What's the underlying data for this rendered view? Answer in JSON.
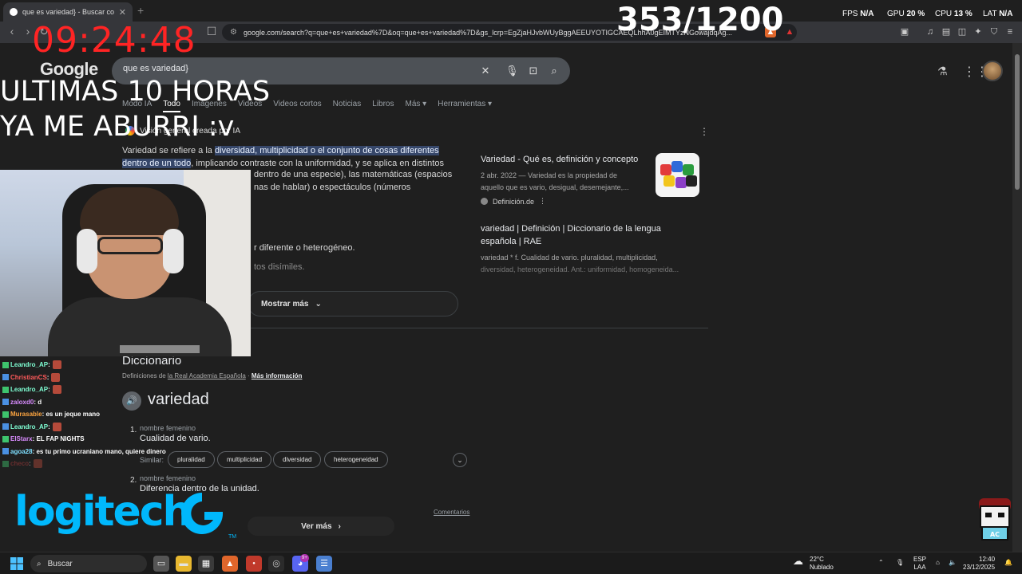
{
  "browser": {
    "tab_title": "que es variedad} - Buscar con G...",
    "url": "google.com/search?q=que+es+variedad%7D&oq=que+es+variedad%7D&gs_lcrp=EgZjaHJvbWUyBggAEEUYOTIGCAEQLhhA0gEIMTYzNGowajdqAg..."
  },
  "search": {
    "logo": "Google",
    "query": "que es variedad}",
    "tabs": [
      "Modo IA",
      "Todo",
      "Imágenes",
      "Videos",
      "Videos cortos",
      "Noticias",
      "Libros",
      "Más",
      "Herramientas"
    ],
    "active_tab": "Todo"
  },
  "ai_overview": {
    "header": "Visión general creada por IA",
    "intro_text": "Variedad se refiere a la ",
    "highlight_1": "diversidad, multiplicidad o el conjunto de cosas diferentes",
    "highlight_2": "dentro de un todo",
    "rest_line2": ", implicando contraste con la uniformidad, y se aplica en distintos",
    "line3": "dentro de una especie), las matemáticas (espacios",
    "line4": "nas de hablar) o espectáculos (números",
    "line5": "r diferente o heterogéneo.",
    "line6": "tos disímiles.",
    "show_more": "Mostrar más"
  },
  "sources": [
    {
      "title": "Variedad - Qué es, definición y concepto",
      "snippet_line1": "2 abr. 2022 — Variedad es la propiedad de",
      "snippet_line2": "aquello que es vario, desigual, desemejante,...",
      "site": "Definición.de"
    },
    {
      "title_line1": "variedad | Definición | Diccionario de la lengua",
      "title_line2": "española | RAE",
      "snippet_line1": "variedad * f. Cualidad de vario. pluralidad, multiplicidad,",
      "snippet_line2": "diversidad, heterogeneidad. Ant.: uniformidad, homogeneida..."
    }
  ],
  "dictionary": {
    "title": "Diccionario",
    "source_prefix": "Definiciones de ",
    "source_name": "la Real Academia Española",
    "more_info": "Más información",
    "word": "variedad",
    "senses": [
      {
        "num": "1.",
        "pos": "nombre femenino",
        "def": "Cualidad de vario."
      },
      {
        "num": "2.",
        "pos": "nombre femenino",
        "def": "Diferencia dentro de la unidad."
      }
    ],
    "similar_label": "Similar:",
    "similar": [
      "pluralidad",
      "multiplicidad",
      "diversidad",
      "heterogeneidad"
    ],
    "feedback": "Comentarios",
    "see_more": "Ver más"
  },
  "overlays": {
    "clock": "09:24:48",
    "counter": "353/1200",
    "line1": "ULTIMAS 10 HORAS",
    "line2": "YA ME ABURRI :v",
    "stats": {
      "fps_label": "FPS",
      "fps_value": "N/A",
      "gpu_label": "GPU",
      "gpu_value": "20",
      "cpu_label": "CPU",
      "cpu_value": "13",
      "lat_label": "LAT",
      "lat_value": "N/A",
      "unit": "%"
    },
    "brand": "logitech",
    "brand_tm": "TM"
  },
  "chat": [
    {
      "name": "Leandro_AP",
      "text": " :",
      "color": "#7fffd4",
      "emote": true
    },
    {
      "name": "ChristianCS",
      "text": " :",
      "color": "#ff5a5a",
      "emote": true
    },
    {
      "name": "Leandro_AP",
      "text": " :",
      "color": "#7fffd4",
      "emote": true
    },
    {
      "name": "zaloxd0",
      "text": " : d",
      "color": "#d98cff",
      "emote": false
    },
    {
      "name": "Murasable",
      "text": " : es un jeque mano",
      "color": "#ffa640",
      "emote": false
    },
    {
      "name": "Leandro_AP",
      "text": " :",
      "color": "#7fffd4",
      "emote": true
    },
    {
      "name": "ElStarx",
      "text": " : EL FAP NIGHTS",
      "color": "#d98cff",
      "emote": false
    },
    {
      "name": "agoa28",
      "text": " : es tu primo ucraniano mano, quiere dinero",
      "color": "#7fe0ff",
      "emote": false
    },
    {
      "name": "checo",
      "text": " :",
      "color": "#c04040",
      "emote": true
    }
  ],
  "taskbar": {
    "search_placeholder": "Buscar",
    "weather_temp": "22°C",
    "weather_desc": "Nublado",
    "lang_line1": "ESP",
    "lang_line2": "LAA",
    "time": "12:40",
    "date": "23/12/2025",
    "badge_count": "9+"
  },
  "colors": {
    "clock_red": "#ff2424",
    "logitech_blue": "#00b8fc",
    "highlight": "#36476a"
  }
}
